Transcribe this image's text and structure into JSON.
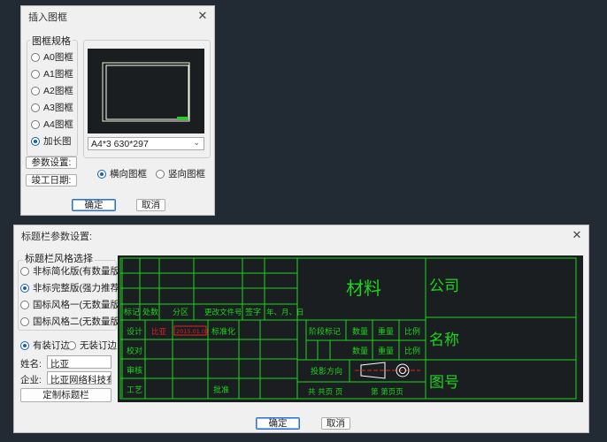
{
  "dialog1": {
    "title": "插入图框",
    "group_title": "图框规格",
    "sizes": [
      "A0图框",
      "A1图框",
      "A2图框",
      "A3图框",
      "A4图框",
      "加长图"
    ],
    "selected_size_index": 5,
    "size_select_value": "A4*3 630*297",
    "btn_params": "参数设置:",
    "btn_date": "竣工日期:",
    "orientations": [
      "横向图框",
      "竖向图框"
    ],
    "selected_orientation_index": 0,
    "ok": "确定",
    "cancel": "取消"
  },
  "dialog2": {
    "title": "标题栏参数设置:",
    "style_group_title": "标题栏风格选择",
    "styles": [
      "非标简化版(有数量版)",
      "非标完整版(强力推荐)",
      "国标风格一(无数量版)",
      "国标风格二(无数量版)"
    ],
    "selected_style_index": 1,
    "binding": [
      "有装订边",
      "无装订边"
    ],
    "selected_binding_index": 0,
    "name_label": "姓名:",
    "name_value": "比亚",
    "company_label": "企业:",
    "company_value": "比亚网络科技有限",
    "custom_btn": "定制标题栏",
    "ok": "确定",
    "cancel": "取消"
  },
  "preview": {
    "col_headers": [
      "标记",
      "处数",
      "分区",
      "更改文件号",
      "签字",
      "年、月、日"
    ],
    "row_labels": [
      "设计",
      "校对",
      "审核",
      "工艺"
    ],
    "std_label": "标准化",
    "approve_label": "批准",
    "stage_label": "阶段标记",
    "qty_label": "数量",
    "weight_label": "重量",
    "scale_label": "比例",
    "material": "材料",
    "company": "公司",
    "name": "名称",
    "drawing_no": "图号",
    "projection_label": "投影方向",
    "sheets_label": "共 共页 页",
    "page_label": "第 第页页",
    "red_name": "比亚",
    "red_box": "2015.01.01"
  },
  "colors": {
    "cad_bg": "#1b1e21",
    "cad_line": "#19d619",
    "cad_accent": "#d8d000",
    "cad_red": "#e02020",
    "selection_blue": "#1a5fb4"
  }
}
